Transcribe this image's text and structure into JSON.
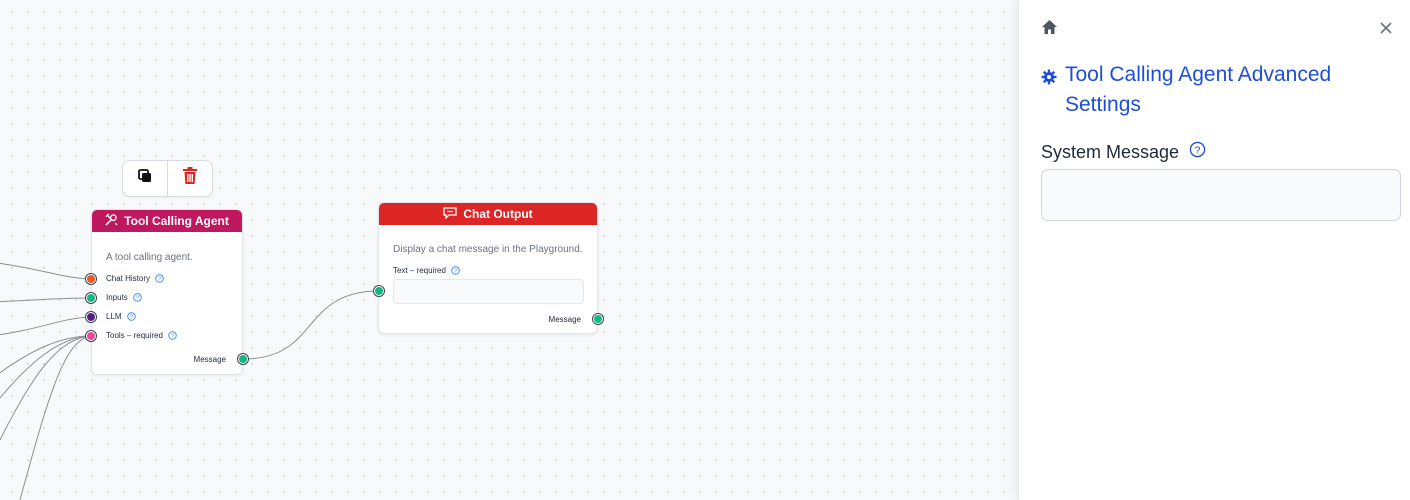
{
  "canvas": {
    "node_toolbar": {
      "duplicate_icon": "copy-icon",
      "delete_icon": "trash-icon"
    },
    "tool_agent_node": {
      "title": "Tool Calling Agent",
      "icon": "tools-icon",
      "header_color": "#c0185f",
      "description": "A tool calling agent.",
      "fields": [
        {
          "label": "Chat History",
          "handle_color": "#f15a24"
        },
        {
          "label": "Inputs",
          "handle_color": "#10b981"
        },
        {
          "label": "LLM",
          "handle_color": "#581c87"
        },
        {
          "label": "Tools",
          "required": " – required",
          "handle_color": "#ec4899"
        }
      ],
      "output_label": "Message",
      "output_handle_color": "#10b981"
    },
    "chat_output_node": {
      "title": "Chat Output",
      "icon": "chat-icon",
      "header_color": "#dc2626",
      "description": "Display a chat message in the Playground.",
      "field_label": "Text",
      "field_required": " – required",
      "text_value": "",
      "output_label": "Message",
      "handle_color": "#10b981"
    }
  },
  "panel": {
    "home_icon": "home-icon",
    "close_icon": "close-icon",
    "settings_icon": "gear-icon",
    "title": "Tool Calling Agent Advanced Settings",
    "system_message_label": "System Message",
    "system_message_value": "",
    "accent": "#1d4ed8"
  }
}
